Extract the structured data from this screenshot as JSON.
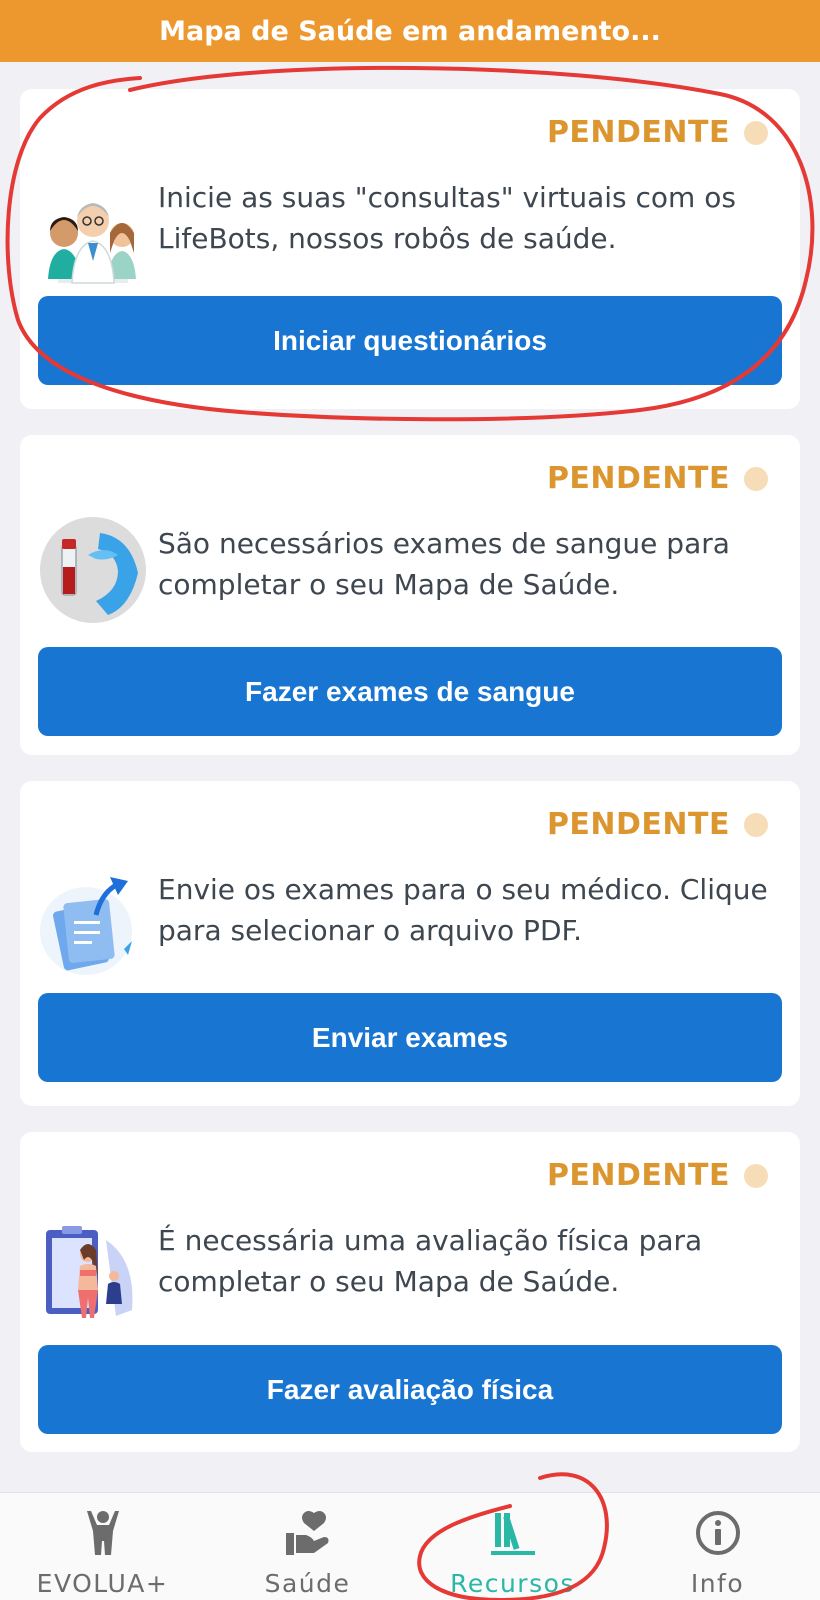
{
  "banner": {
    "text": "Mapa de Saúde em andamento..."
  },
  "colors": {
    "banner": "#ec982f",
    "status": "#dc962f",
    "status_dot": "#f7dcb8",
    "button": "#1876d2",
    "nav_active": "#2bb7a6",
    "nav_inactive": "#6c6c6c",
    "annotation": "#e53935"
  },
  "cards": [
    {
      "status": "PENDENTE",
      "icon": "doctors-illustration",
      "description": "Inicie as suas \"consultas\" virtuais com os LifeBots, nossos robôs de saúde.",
      "button": "Iniciar questionários"
    },
    {
      "status": "PENDENTE",
      "icon": "blood-test-illustration",
      "description": "São necessários exames de sangue para completar o seu Mapa de Saúde.",
      "button": "Fazer exames de sangue"
    },
    {
      "status": "PENDENTE",
      "icon": "document-upload-illustration",
      "description": "Envie os exames para o seu médico. Clique para selecionar o arquivo PDF.",
      "button": "Enviar exames"
    },
    {
      "status": "PENDENTE",
      "icon": "physical-assessment-illustration",
      "description": "É necessária uma avaliação física para completar o seu Mapa de Saúde.",
      "button": "Fazer avaliação física"
    }
  ],
  "nav": {
    "items": [
      {
        "label": "EVOLUA+",
        "icon": "person-icon",
        "active": false
      },
      {
        "label": "Saúde",
        "icon": "heart-hand-icon",
        "active": false
      },
      {
        "label": "Recursos",
        "icon": "books-icon",
        "active": true
      },
      {
        "label": "Info",
        "icon": "info-icon",
        "active": false
      }
    ]
  }
}
